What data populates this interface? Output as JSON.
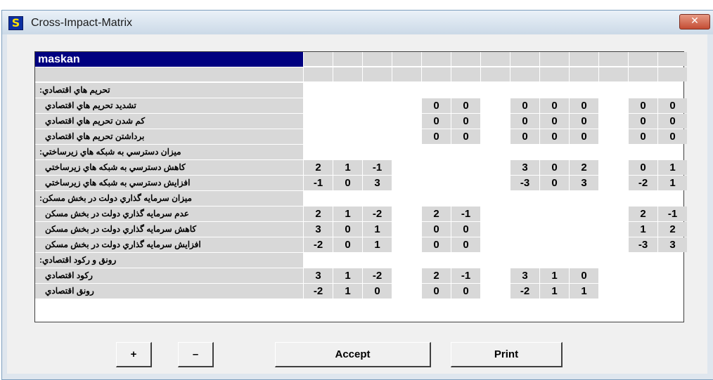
{
  "window": {
    "title": "Cross-Impact-Matrix",
    "icon": "app-icon",
    "icon_glyph": "S",
    "close_glyph": "✕"
  },
  "matrix": {
    "corner_title": "maskan",
    "column_count": 13,
    "rows": [
      {
        "type": "group",
        "label": "تحريم هاي اقتصادي:",
        "values": []
      },
      {
        "type": "item",
        "label": "تشديد تحريم هاي اقتصادي",
        "values": [
          "",
          "",
          "",
          "",
          "0",
          "0",
          "",
          "0",
          "0",
          "0",
          "",
          "0",
          "0"
        ]
      },
      {
        "type": "item",
        "label": "كم شدن تحريم هاي اقتصادي",
        "values": [
          "",
          "",
          "",
          "",
          "0",
          "0",
          "",
          "0",
          "0",
          "0",
          "",
          "0",
          "0"
        ]
      },
      {
        "type": "item",
        "label": "برداشتن تحريم هاي اقتصادي",
        "values": [
          "",
          "",
          "",
          "",
          "0",
          "0",
          "",
          "0",
          "0",
          "0",
          "",
          "0",
          "0"
        ]
      },
      {
        "type": "group",
        "label": "ميزان دسترسي به شبكه هاي زيرساختي:",
        "values": []
      },
      {
        "type": "item",
        "label": "كاهش دسترسي به شبكه هاي زيرساختي",
        "values": [
          "2",
          "1",
          "-1",
          "",
          "",
          "",
          "",
          "3",
          "0",
          "2",
          "",
          "0",
          "1"
        ]
      },
      {
        "type": "item",
        "label": "افزايش دسترسي به شبكه هاي زيرساختي",
        "values": [
          "-1",
          "0",
          "3",
          "",
          "",
          "",
          "",
          "-3",
          "0",
          "3",
          "",
          "-2",
          "1"
        ]
      },
      {
        "type": "group",
        "label": "ميزان سرمايه گذاري دولت در بخش مسكن:",
        "values": []
      },
      {
        "type": "item",
        "label": "عدم سرمايه گذاري دولت در بخش مسكن",
        "values": [
          "2",
          "1",
          "-2",
          "",
          "2",
          "-1",
          "",
          "",
          "",
          "",
          "",
          "2",
          "-1"
        ]
      },
      {
        "type": "item",
        "label": "كاهش سرمايه گذاري دولت در بخش مسكن",
        "values": [
          "3",
          "0",
          "1",
          "",
          "0",
          "0",
          "",
          "",
          "",
          "",
          "",
          "1",
          "2"
        ]
      },
      {
        "type": "item",
        "label": "افزايش سرمايه گذاري دولت در بخش مسكن",
        "values": [
          "-2",
          "0",
          "1",
          "",
          "0",
          "0",
          "",
          "",
          "",
          "",
          "",
          "-3",
          "3"
        ]
      },
      {
        "type": "group",
        "label": "رونق و ركود اقتصادي:",
        "values": []
      },
      {
        "type": "item",
        "label": "ركود اقتصادي",
        "values": [
          "3",
          "1",
          "-2",
          "",
          "2",
          "-1",
          "",
          "3",
          "1",
          "0",
          "",
          "",
          ""
        ]
      },
      {
        "type": "item",
        "label": "رونق اقتصادي",
        "values": [
          "-2",
          "1",
          "0",
          "",
          "0",
          "0",
          "",
          "-2",
          "1",
          "1",
          "",
          "",
          ""
        ]
      }
    ]
  },
  "buttons": {
    "plus": "+",
    "minus": "–",
    "accept": "Accept",
    "print": "Print"
  }
}
